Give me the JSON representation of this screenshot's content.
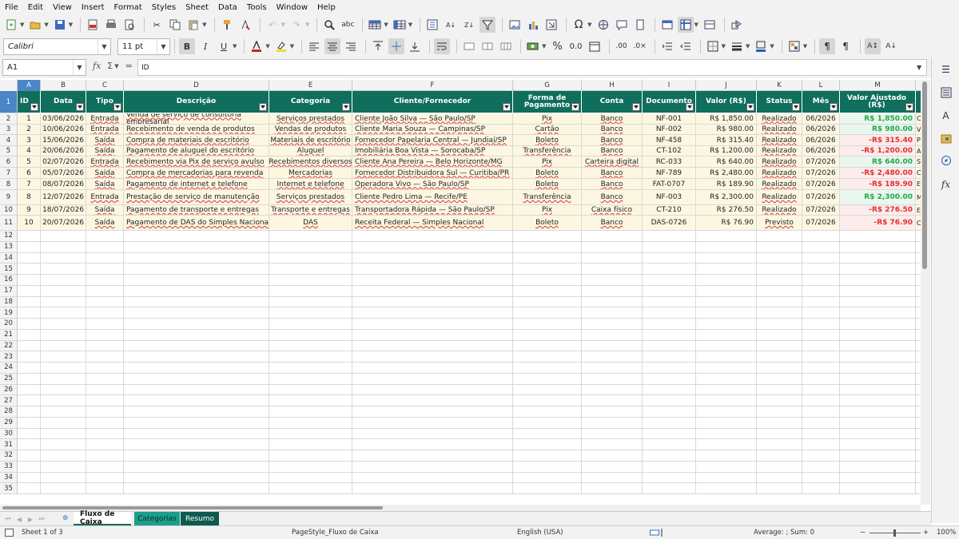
{
  "menu": [
    "File",
    "Edit",
    "View",
    "Insert",
    "Format",
    "Styles",
    "Sheet",
    "Data",
    "Tools",
    "Window",
    "Help"
  ],
  "formatting": {
    "font_name": "Calibri",
    "font_size": "11 pt"
  },
  "formula_bar": {
    "name_box": "A1",
    "content": "ID"
  },
  "columns": [
    "A",
    "B",
    "C",
    "D",
    "E",
    "F",
    "G",
    "H",
    "I",
    "J",
    "K",
    "L",
    "M"
  ],
  "headers": [
    "ID",
    "Data",
    "Tipo",
    "Descrição",
    "Categoria",
    "Cliente/Fornecedor",
    "Forma de Pagamento",
    "Conta",
    "Documento",
    "Valor (R$)",
    "Status",
    "Mês",
    "Valor Ajustado (R$)"
  ],
  "rows": [
    {
      "id": "1",
      "data": "03/06/2026",
      "tipo": "Entrada",
      "descricao": "Venda de serviço de consultoria empresarial",
      "categoria": "Serviços prestados",
      "cliente": "Cliente João Silva — São Paulo/SP",
      "forma": "Pix",
      "conta": "Banco",
      "documento": "NF-001",
      "valor": "R$ 1,850.00",
      "status": "Realizado",
      "mes": "06/2026",
      "ajustado": "R$ 1,850.00",
      "sign": "pos",
      "extra": "C"
    },
    {
      "id": "2",
      "data": "10/06/2026",
      "tipo": "Entrada",
      "descricao": "Recebimento de venda de produtos",
      "categoria": "Vendas de produtos",
      "cliente": "Cliente Maria Souza — Campinas/SP",
      "forma": "Cartão",
      "conta": "Banco",
      "documento": "NF-002",
      "valor": "R$ 980.00",
      "status": "Realizado",
      "mes": "06/2026",
      "ajustado": "R$ 980.00",
      "sign": "pos",
      "extra": "V"
    },
    {
      "id": "3",
      "data": "15/06/2026",
      "tipo": "Saída",
      "descricao": "Compra de materiais de escritório",
      "categoria": "Materiais de escritório",
      "cliente": "Fornecedor Papelaria Central — Jundiaí/SP",
      "forma": "Boleto",
      "conta": "Banco",
      "documento": "NF-458",
      "valor": "R$ 315.40",
      "status": "Realizado",
      "mes": "06/2026",
      "ajustado": "-R$ 315.40",
      "sign": "neg",
      "extra": "P"
    },
    {
      "id": "4",
      "data": "20/06/2026",
      "tipo": "Saída",
      "descricao": "Pagamento de aluguel do escritório",
      "categoria": "Aluguel",
      "cliente": "Imobiliária Boa Vista — Sorocaba/SP",
      "forma": "Transferência",
      "conta": "Banco",
      "documento": "CT-102",
      "valor": "R$ 1,200.00",
      "status": "Realizado",
      "mes": "06/2026",
      "ajustado": "-R$ 1,200.00",
      "sign": "neg",
      "extra": "A"
    },
    {
      "id": "5",
      "data": "02/07/2026",
      "tipo": "Entrada",
      "descricao": "Recebimento via Pix de serviço avulso",
      "categoria": "Recebimentos diversos",
      "cliente": "Cliente Ana Pereira — Belo Horizonte/MG",
      "forma": "Pix",
      "conta": "Carteira digital",
      "documento": "RC-033",
      "valor": "R$ 640.00",
      "status": "Realizado",
      "mes": "07/2026",
      "ajustado": "R$ 640.00",
      "sign": "pos",
      "extra": "S"
    },
    {
      "id": "6",
      "data": "05/07/2026",
      "tipo": "Saída",
      "descricao": "Compra de mercadorias para revenda",
      "categoria": "Mercadorias",
      "cliente": "Fornecedor Distribuidora Sul — Curitiba/PR",
      "forma": "Boleto",
      "conta": "Banco",
      "documento": "NF-789",
      "valor": "R$ 2,480.00",
      "status": "Realizado",
      "mes": "07/2026",
      "ajustado": "-R$ 2,480.00",
      "sign": "neg",
      "extra": "C"
    },
    {
      "id": "7",
      "data": "08/07/2026",
      "tipo": "Saída",
      "descricao": "Pagamento de internet e telefone",
      "categoria": "Internet e telefone",
      "cliente": "Operadora Vivo — São Paulo/SP",
      "forma": "Boleto",
      "conta": "Banco",
      "documento": "FAT-0707",
      "valor": "R$ 189.90",
      "status": "Realizado",
      "mes": "07/2026",
      "ajustado": "-R$ 189.90",
      "sign": "neg",
      "extra": "E"
    },
    {
      "id": "8",
      "data": "12/07/2026",
      "tipo": "Entrada",
      "descricao": "Prestação de serviço de manutenção",
      "categoria": "Serviços prestados",
      "cliente": "Cliente Pedro Lima — Recife/PE",
      "forma": "Transferência",
      "conta": "Banco",
      "documento": "NF-003",
      "valor": "R$ 2,300.00",
      "status": "Realizado",
      "mes": "07/2026",
      "ajustado": "R$ 2,300.00",
      "sign": "pos",
      "extra": "M"
    },
    {
      "id": "9",
      "data": "18/07/2026",
      "tipo": "Saída",
      "descricao": "Pagamento de transporte e entregas",
      "categoria": "Transporte e entregas",
      "cliente": "Transportadora Rápida — São Paulo/SP",
      "forma": "Pix",
      "conta": "Caixa físico",
      "documento": "CT-210",
      "valor": "R$ 276.50",
      "status": "Realizado",
      "mes": "07/2026",
      "ajustado": "-R$ 276.50",
      "sign": "neg",
      "extra": "E"
    },
    {
      "id": "10",
      "data": "20/07/2026",
      "tipo": "Saída",
      "descricao": "Pagamento de DAS do Simples Nacional",
      "categoria": "DAS",
      "cliente": "Receita Federal — Simples Nacional",
      "forma": "Boleto",
      "conta": "Banco",
      "documento": "DAS-0726",
      "valor": "R$ 76.90",
      "status": "Previsto",
      "mes": "07/2026",
      "ajustado": "-R$ 76.90",
      "sign": "neg",
      "extra": "C"
    }
  ],
  "empty_rows": [
    "12",
    "13",
    "14",
    "15",
    "16",
    "17",
    "18",
    "19",
    "20",
    "21",
    "22",
    "23",
    "24",
    "25",
    "26",
    "27",
    "28",
    "29",
    "30",
    "31",
    "32",
    "33",
    "34",
    "35"
  ],
  "sheet_tabs": [
    "Fluxo de Caixa",
    "Categorias",
    "Resumo"
  ],
  "status": {
    "sheet": "Sheet 1 of 3",
    "page_style": "PageStyle_Fluxo de Caixa",
    "language": "English (USA)",
    "summary": "Average: ; Sum: 0",
    "zoom": "100%"
  },
  "colors": {
    "header_bg": "#0f6e5c",
    "row_bg": "#fdf7e2",
    "positive": "#22a84a",
    "negative": "#e03030",
    "tab_categorias": "#1b9e8a",
    "tab_resumo": "#0d5a4e"
  }
}
